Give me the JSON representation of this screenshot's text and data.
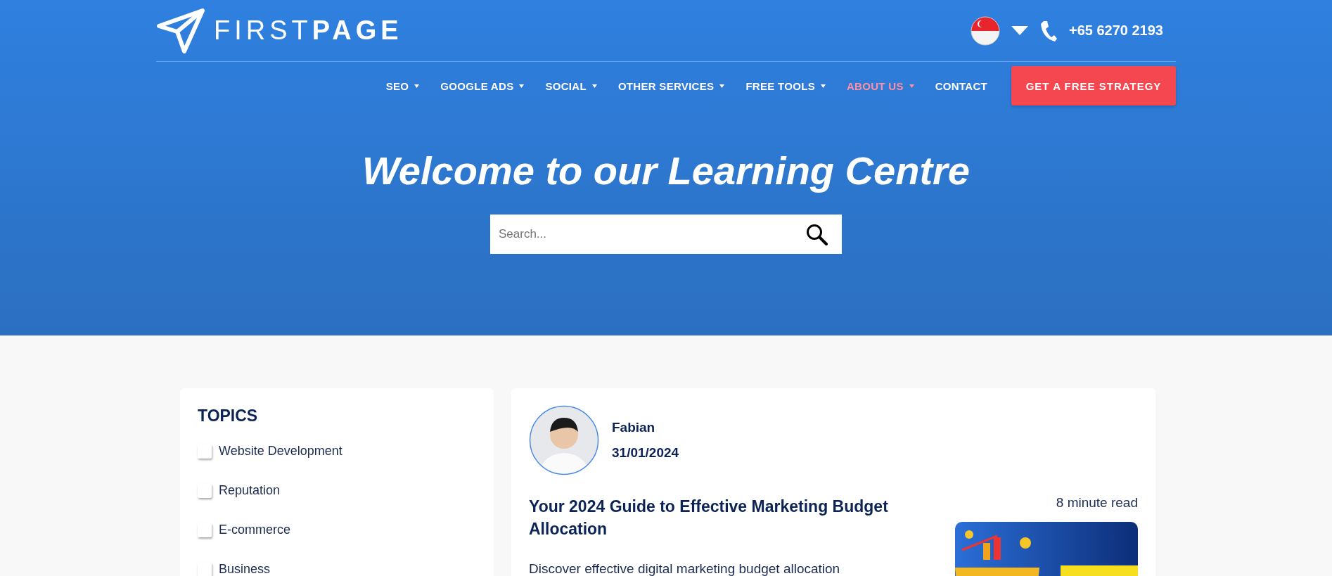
{
  "header": {
    "logo": {
      "light": "FIRST",
      "bold": "PAGE"
    },
    "phone": "+65 6270 2193",
    "nav": [
      {
        "label": "SEO",
        "dropdown": true,
        "selected": false
      },
      {
        "label": "GOOGLE ADS",
        "dropdown": true,
        "selected": false
      },
      {
        "label": "SOCIAL",
        "dropdown": true,
        "selected": false
      },
      {
        "label": "OTHER SERVICES",
        "dropdown": true,
        "selected": false
      },
      {
        "label": "FREE TOOLS",
        "dropdown": true,
        "selected": false
      },
      {
        "label": "ABOUT US",
        "dropdown": true,
        "selected": true
      },
      {
        "label": "CONTACT",
        "dropdown": false,
        "selected": false
      }
    ],
    "cta": "GET A FREE STRATEGY"
  },
  "hero": {
    "title": "Welcome to our Learning Centre",
    "search": {
      "placeholder": "Search..."
    }
  },
  "topics": {
    "title": "TOPICS",
    "items": [
      {
        "label": "Website Development",
        "checked": false
      },
      {
        "label": "Reputation",
        "checked": false
      },
      {
        "label": "E-commerce",
        "checked": false
      },
      {
        "label": "Business",
        "checked": false
      }
    ]
  },
  "article": {
    "author": "Fabian",
    "date": "31/01/2024",
    "read_time": "8 minute read",
    "title": "Your 2024 Guide to Effective Marketing Budget Allocation",
    "excerpt": "Discover effective digital marketing budget allocation"
  }
}
